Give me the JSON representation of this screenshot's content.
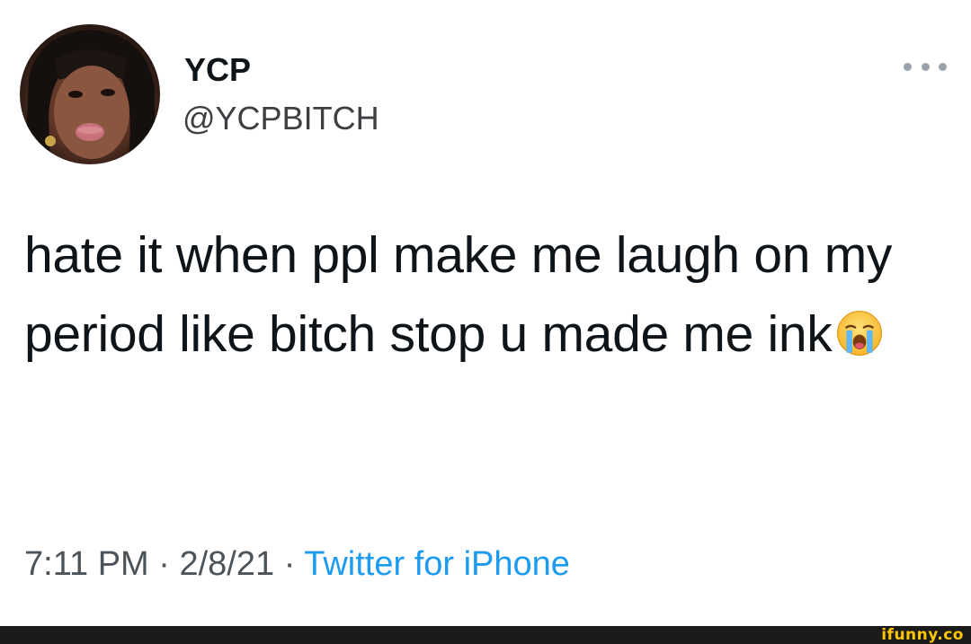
{
  "user": {
    "display_name": "YCP",
    "handle": "@YCPBITCH"
  },
  "tweet": {
    "text": "hate it when ppl make me laugh on my period like bitch stop u made me ink",
    "emoji_icon": "loudly-crying-face-icon"
  },
  "meta": {
    "time": "7:11 PM",
    "separator": " · ",
    "date": "2/8/21",
    "source": "Twitter for iPhone"
  },
  "watermark": {
    "text": "ifunny.co",
    "color": "#fcc600"
  },
  "colors": {
    "link": "#1d9bf0",
    "text": "#0f1419",
    "secondary": "#4d5459"
  }
}
